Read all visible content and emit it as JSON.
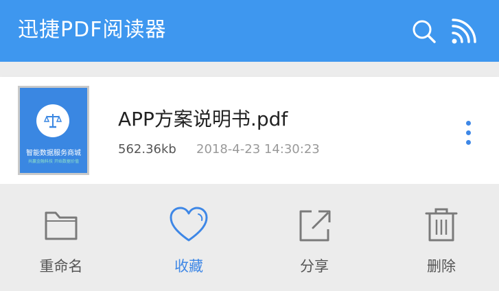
{
  "appbar": {
    "title": "迅捷PDF阅读器",
    "color": "#3e97ef",
    "icons": [
      "search-icon",
      "cast-icon"
    ]
  },
  "file": {
    "name": "APP方案说明书.pdf",
    "size": "562.36kb",
    "date": "2018-4-23 14:30:23",
    "thumbnail": {
      "title": "智能数据服务商城",
      "subtitle": "共赢金融科技    开始数据价值",
      "icon": "scales-icon"
    }
  },
  "actions": [
    {
      "label": "重命名",
      "icon": "folder-icon",
      "active": false
    },
    {
      "label": "收藏",
      "icon": "heart-icon",
      "active": true
    },
    {
      "label": "分享",
      "icon": "share-icon",
      "active": false
    },
    {
      "label": "删除",
      "icon": "trash-icon",
      "active": false
    }
  ],
  "colors": {
    "accent": "#3e87e6",
    "background": "#ececec"
  }
}
